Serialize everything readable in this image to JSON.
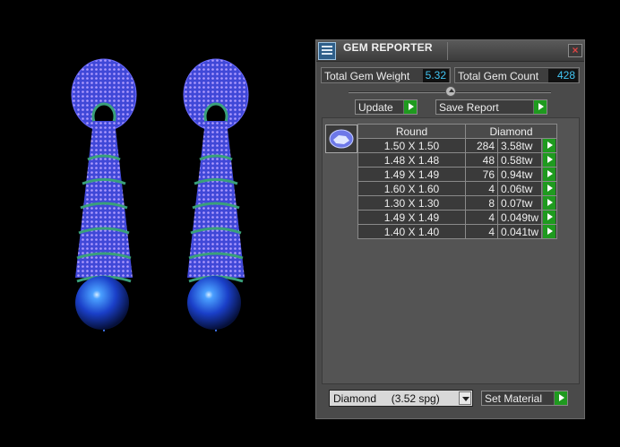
{
  "panel": {
    "title": "GEM REPORTER",
    "close_label": "×"
  },
  "stats": {
    "weight_label": "Total Gem Weight",
    "weight_value": "5.32",
    "count_label": "Total Gem Count",
    "count_value": "428"
  },
  "buttons": {
    "update_label": "Update",
    "save_label": "Save Report",
    "set_material_label": "Set Material"
  },
  "table": {
    "headers": [
      "Round",
      "Diamond"
    ],
    "rows": [
      {
        "size": "1.50 X 1.50",
        "count": "284",
        "weight": "3.58tw"
      },
      {
        "size": "1.48 X 1.48",
        "count": "48",
        "weight": "0.58tw"
      },
      {
        "size": "1.49 X 1.49",
        "count": "76",
        "weight": "0.94tw"
      },
      {
        "size": "1.60 X 1.60",
        "count": "4",
        "weight": "0.06tw"
      },
      {
        "size": "1.30 X 1.30",
        "count": "8",
        "weight": "0.07tw"
      },
      {
        "size": "1.49 X 1.49",
        "count": "4",
        "weight": "0.049tw"
      },
      {
        "size": "1.40 X 1.40",
        "count": "4",
        "weight": "0.041tw"
      }
    ]
  },
  "material_select": {
    "value": "Diamond     (3.52 spg)"
  },
  "colors": {
    "accent_value": "#42c6f4",
    "play_green": "#1f9a1f",
    "gem_blue": "#3b4fd8",
    "metal_green": "#3aa07a"
  },
  "icons": {
    "title": "gem-reporter-icon",
    "close": "close-icon",
    "slider": "slider-knob-icon",
    "play": "play-arrow-icon",
    "gem": "round-gem-icon",
    "dropdown": "chevron-down-icon"
  }
}
